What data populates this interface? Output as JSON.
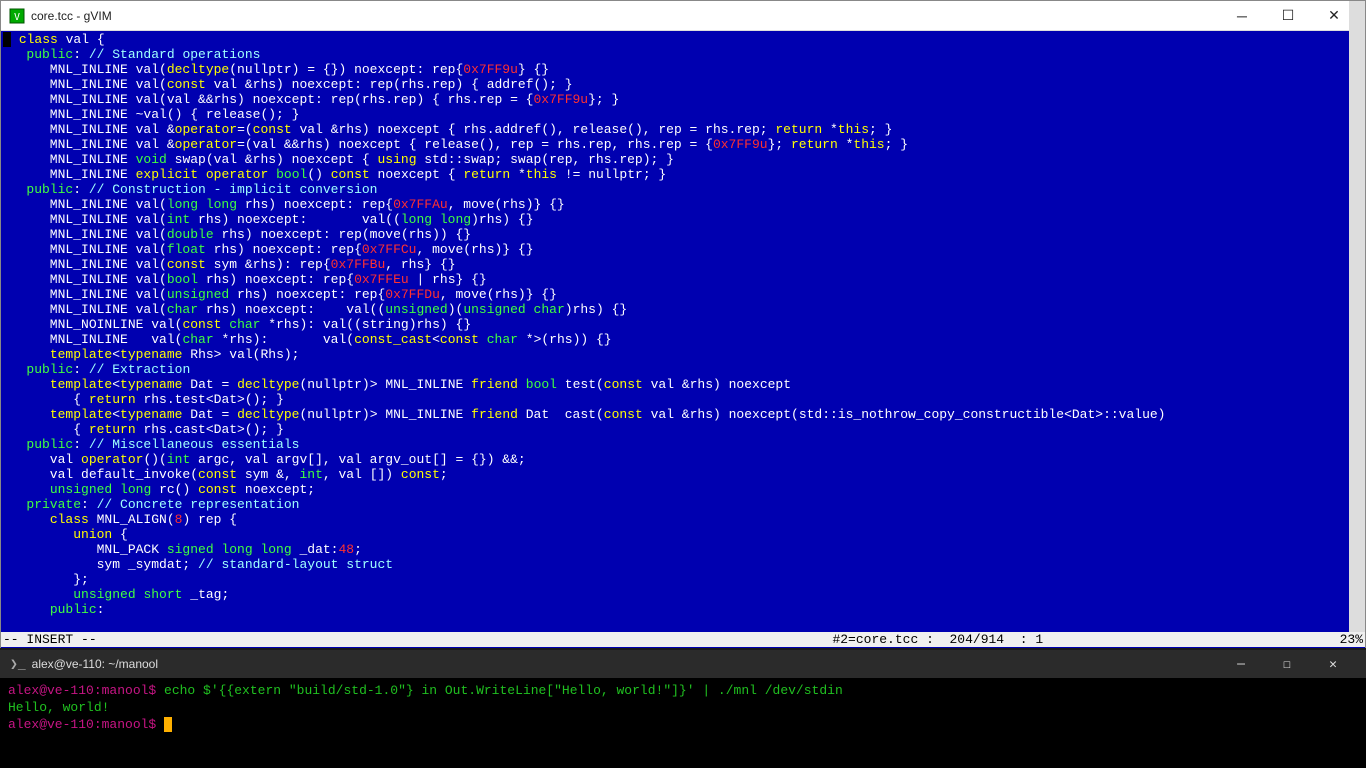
{
  "gvim": {
    "title": "core.tcc - gVIM",
    "status_mode": "-- INSERT --",
    "status_buffer": "#2=core.tcc",
    "status_pos": "204/914",
    "status_col": "1",
    "status_percent": "23%",
    "code": [
      [
        [
          "cursor",
          ""
        ],
        [
          " ",
          "w"
        ],
        [
          "class",
          "y"
        ],
        [
          " val {",
          "w"
        ]
      ],
      [
        [
          "   ",
          "w"
        ],
        [
          "public",
          "g"
        ],
        [
          ": ",
          "w"
        ],
        [
          "// Standard operations",
          "lc"
        ]
      ],
      [
        [
          "      MNL_INLINE val(",
          "w"
        ],
        [
          "decltype",
          "y"
        ],
        [
          "(nullptr) = {}) noexcept: rep{",
          "w"
        ],
        [
          "0x7FF9u",
          "r"
        ],
        [
          "} {}",
          "w"
        ]
      ],
      [
        [
          "      MNL_INLINE val(",
          "w"
        ],
        [
          "const",
          "y"
        ],
        [
          " val &rhs) noexcept: rep(rhs.rep) { addref(); }",
          "w"
        ]
      ],
      [
        [
          "      MNL_INLINE val(val &&rhs) noexcept: rep(rhs.rep) { rhs.rep = {",
          "w"
        ],
        [
          "0x7FF9u",
          "r"
        ],
        [
          "}; }",
          "w"
        ]
      ],
      [
        [
          "      MNL_INLINE ~val() { release(); }",
          "w"
        ]
      ],
      [
        [
          "      MNL_INLINE val &",
          "w"
        ],
        [
          "operator",
          "y"
        ],
        [
          "=(",
          "w"
        ],
        [
          "const",
          "y"
        ],
        [
          " val &rhs) noexcept { rhs.addref(), release(), rep = rhs.rep; ",
          "w"
        ],
        [
          "return",
          "y"
        ],
        [
          " *",
          "w"
        ],
        [
          "this",
          "y"
        ],
        [
          "; }",
          "w"
        ]
      ],
      [
        [
          "      MNL_INLINE val &",
          "w"
        ],
        [
          "operator",
          "y"
        ],
        [
          "=(val &&rhs) noexcept { release(), rep = rhs.rep, rhs.rep = {",
          "w"
        ],
        [
          "0x7FF9u",
          "r"
        ],
        [
          "}; ",
          "w"
        ],
        [
          "return",
          "y"
        ],
        [
          " *",
          "w"
        ],
        [
          "this",
          "y"
        ],
        [
          "; }",
          "w"
        ]
      ],
      [
        [
          "      MNL_INLINE ",
          "w"
        ],
        [
          "void",
          "g"
        ],
        [
          " swap(val &rhs) noexcept { ",
          "w"
        ],
        [
          "using",
          "y"
        ],
        [
          " std::swap; swap(rep, rhs.rep); }",
          "w"
        ]
      ],
      [
        [
          "      MNL_INLINE ",
          "w"
        ],
        [
          "explicit",
          "y"
        ],
        [
          " ",
          "w"
        ],
        [
          "operator",
          "y"
        ],
        [
          " ",
          "w"
        ],
        [
          "bool",
          "g"
        ],
        [
          "() ",
          "w"
        ],
        [
          "const",
          "y"
        ],
        [
          " noexcept { ",
          "w"
        ],
        [
          "return",
          "y"
        ],
        [
          " *",
          "w"
        ],
        [
          "this",
          "y"
        ],
        [
          " != nullptr; }",
          "w"
        ]
      ],
      [
        [
          "   ",
          "w"
        ],
        [
          "public",
          "g"
        ],
        [
          ": ",
          "w"
        ],
        [
          "// Construction - implicit conversion",
          "lc"
        ]
      ],
      [
        [
          "      MNL_INLINE val(",
          "w"
        ],
        [
          "long long",
          "g"
        ],
        [
          " rhs) noexcept: rep{",
          "w"
        ],
        [
          "0x7FFAu",
          "r"
        ],
        [
          ", move(rhs)} {}",
          "w"
        ]
      ],
      [
        [
          "      MNL_INLINE val(",
          "w"
        ],
        [
          "int",
          "g"
        ],
        [
          " rhs) noexcept:       val((",
          "w"
        ],
        [
          "long long",
          "g"
        ],
        [
          ")rhs) {}",
          "w"
        ]
      ],
      [
        [
          "      MNL_INLINE val(",
          "w"
        ],
        [
          "double",
          "g"
        ],
        [
          " rhs) noexcept: rep(move(rhs)) {}",
          "w"
        ]
      ],
      [
        [
          "      MNL_INLINE val(",
          "w"
        ],
        [
          "float",
          "g"
        ],
        [
          " rhs) noexcept: rep{",
          "w"
        ],
        [
          "0x7FFCu",
          "r"
        ],
        [
          ", move(rhs)} {}",
          "w"
        ]
      ],
      [
        [
          "      MNL_INLINE val(",
          "w"
        ],
        [
          "const",
          "y"
        ],
        [
          " sym &rhs): rep{",
          "w"
        ],
        [
          "0x7FFBu",
          "r"
        ],
        [
          ", rhs} {}",
          "w"
        ]
      ],
      [
        [
          "      MNL_INLINE val(",
          "w"
        ],
        [
          "bool",
          "g"
        ],
        [
          " rhs) noexcept: rep{",
          "w"
        ],
        [
          "0x7FFEu",
          "r"
        ],
        [
          " | rhs} {}",
          "w"
        ]
      ],
      [
        [
          "      MNL_INLINE val(",
          "w"
        ],
        [
          "unsigned",
          "g"
        ],
        [
          " rhs) noexcept: rep{",
          "w"
        ],
        [
          "0x7FFDu",
          "r"
        ],
        [
          ", move(rhs)} {}",
          "w"
        ]
      ],
      [
        [
          "      MNL_INLINE val(",
          "w"
        ],
        [
          "char",
          "g"
        ],
        [
          " rhs) noexcept:    val((",
          "w"
        ],
        [
          "unsigned",
          "g"
        ],
        [
          ")(",
          "w"
        ],
        [
          "unsigned",
          "g"
        ],
        [
          " ",
          "w"
        ],
        [
          "char",
          "g"
        ],
        [
          ")rhs) {}",
          "w"
        ]
      ],
      [
        [
          "      MNL_NOINLINE val(",
          "w"
        ],
        [
          "const",
          "y"
        ],
        [
          " ",
          "w"
        ],
        [
          "char",
          "g"
        ],
        [
          " *rhs): val((string)rhs) {}",
          "w"
        ]
      ],
      [
        [
          "      MNL_INLINE   val(",
          "w"
        ],
        [
          "char",
          "g"
        ],
        [
          " *rhs):       val(",
          "w"
        ],
        [
          "const_cast",
          "y"
        ],
        [
          "<",
          "w"
        ],
        [
          "const",
          "y"
        ],
        [
          " ",
          "w"
        ],
        [
          "char",
          "g"
        ],
        [
          " *>(rhs)) {}",
          "w"
        ]
      ],
      [
        [
          "      ",
          "w"
        ],
        [
          "template",
          "y"
        ],
        [
          "<",
          "w"
        ],
        [
          "typename",
          "y"
        ],
        [
          " Rhs> val(Rhs);",
          "w"
        ]
      ],
      [
        [
          "   ",
          "w"
        ],
        [
          "public",
          "g"
        ],
        [
          ": ",
          "w"
        ],
        [
          "// Extraction",
          "lc"
        ]
      ],
      [
        [
          "      ",
          "w"
        ],
        [
          "template",
          "y"
        ],
        [
          "<",
          "w"
        ],
        [
          "typename",
          "y"
        ],
        [
          " Dat = ",
          "w"
        ],
        [
          "decltype",
          "y"
        ],
        [
          "(nullptr)> MNL_INLINE ",
          "w"
        ],
        [
          "friend",
          "y"
        ],
        [
          " ",
          "w"
        ],
        [
          "bool",
          "g"
        ],
        [
          " test(",
          "w"
        ],
        [
          "const",
          "y"
        ],
        [
          " val &rhs) noexcept",
          "w"
        ]
      ],
      [
        [
          "         { ",
          "w"
        ],
        [
          "return",
          "y"
        ],
        [
          " rhs.test<Dat>(); }",
          "w"
        ]
      ],
      [
        [
          "      ",
          "w"
        ],
        [
          "template",
          "y"
        ],
        [
          "<",
          "w"
        ],
        [
          "typename",
          "y"
        ],
        [
          " Dat = ",
          "w"
        ],
        [
          "decltype",
          "y"
        ],
        [
          "(nullptr)> MNL_INLINE ",
          "w"
        ],
        [
          "friend",
          "y"
        ],
        [
          " Dat  cast(",
          "w"
        ],
        [
          "const",
          "y"
        ],
        [
          " val &rhs) noexcept(std::is_nothrow_copy_constructible<Dat>::value)",
          "w"
        ]
      ],
      [
        [
          "         { ",
          "w"
        ],
        [
          "return",
          "y"
        ],
        [
          " rhs.cast<Dat>(); }",
          "w"
        ]
      ],
      [
        [
          "   ",
          "w"
        ],
        [
          "public",
          "g"
        ],
        [
          ": ",
          "w"
        ],
        [
          "// Miscellaneous essentials",
          "lc"
        ]
      ],
      [
        [
          "      val ",
          "w"
        ],
        [
          "operator",
          "y"
        ],
        [
          "()(",
          "w"
        ],
        [
          "int",
          "g"
        ],
        [
          " argc, val argv[], val argv_out[] = {}) &&;",
          "w"
        ]
      ],
      [
        [
          "      val default_invoke(",
          "w"
        ],
        [
          "const",
          "y"
        ],
        [
          " sym &, ",
          "w"
        ],
        [
          "int",
          "g"
        ],
        [
          ", val []) ",
          "w"
        ],
        [
          "const",
          "y"
        ],
        [
          ";",
          "w"
        ]
      ],
      [
        [
          "      ",
          "w"
        ],
        [
          "unsigned",
          "g"
        ],
        [
          " ",
          "w"
        ],
        [
          "long",
          "g"
        ],
        [
          " rc() ",
          "w"
        ],
        [
          "const",
          "y"
        ],
        [
          " noexcept;",
          "w"
        ]
      ],
      [
        [
          "   ",
          "w"
        ],
        [
          "private",
          "g"
        ],
        [
          ": ",
          "w"
        ],
        [
          "// Concrete representation",
          "lc"
        ]
      ],
      [
        [
          "      ",
          "w"
        ],
        [
          "class",
          "y"
        ],
        [
          " MNL_ALIGN(",
          "w"
        ],
        [
          "8",
          "r"
        ],
        [
          ") rep {",
          "w"
        ]
      ],
      [
        [
          "         ",
          "w"
        ],
        [
          "union",
          "y"
        ],
        [
          " {",
          "w"
        ]
      ],
      [
        [
          "            MNL_PACK ",
          "w"
        ],
        [
          "signed",
          "g"
        ],
        [
          " ",
          "w"
        ],
        [
          "long long",
          "g"
        ],
        [
          " _dat:",
          "w"
        ],
        [
          "48",
          "r"
        ],
        [
          ";",
          "w"
        ]
      ],
      [
        [
          "            sym _symdat; ",
          "w"
        ],
        [
          "// standard-layout struct",
          "lc"
        ]
      ],
      [
        [
          "         };",
          "w"
        ]
      ],
      [
        [
          "         ",
          "w"
        ],
        [
          "unsigned",
          "g"
        ],
        [
          " ",
          "w"
        ],
        [
          "short",
          "g"
        ],
        [
          " _tag;",
          "w"
        ]
      ],
      [
        [
          "      ",
          "w"
        ],
        [
          "public",
          "g"
        ],
        [
          ":",
          "w"
        ]
      ]
    ]
  },
  "terminal": {
    "title": "alex@ve-110: ~/manool",
    "lines": [
      {
        "prompt": "alex@ve-110:manool$ ",
        "cmd": "echo $'{{extern \"build/std-1.0\"} in Out.WriteLine[\"Hello, world!\"]}' | ./mnl /dev/stdin"
      },
      {
        "out": "Hello, world!"
      },
      {
        "prompt": "alex@ve-110:manool$ ",
        "cursor": true
      }
    ]
  }
}
